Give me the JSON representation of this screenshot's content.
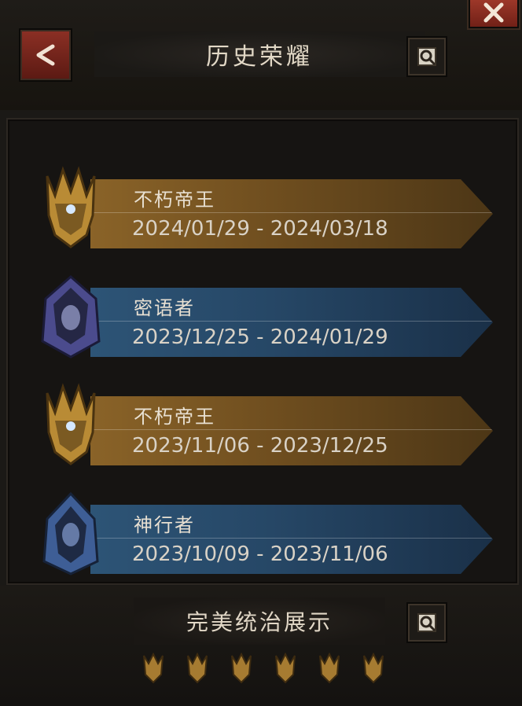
{
  "header": {
    "title": "历史荣耀"
  },
  "honors": [
    {
      "title": "不朽帝王",
      "dates": "2024/01/29 - 2024/03/18",
      "style": "gold",
      "emblem": "golden-horned-helm-icon"
    },
    {
      "title": "密语者",
      "dates": "2023/12/25 - 2024/01/29",
      "style": "blue",
      "emblem": "hooded-whisperer-icon"
    },
    {
      "title": "不朽帝王",
      "dates": "2023/11/06 - 2023/12/25",
      "style": "gold",
      "emblem": "golden-horned-helm-icon"
    },
    {
      "title": "神行者",
      "dates": "2023/10/09 - 2023/11/06",
      "style": "blue",
      "emblem": "hooded-wanderer-icon"
    }
  ],
  "showcase": {
    "title": "完美统治展示",
    "crest_count": 6
  },
  "colors": {
    "gold_banner": "#8a6328",
    "blue_banner": "#2d5476",
    "red_button": "#8b2f24"
  }
}
